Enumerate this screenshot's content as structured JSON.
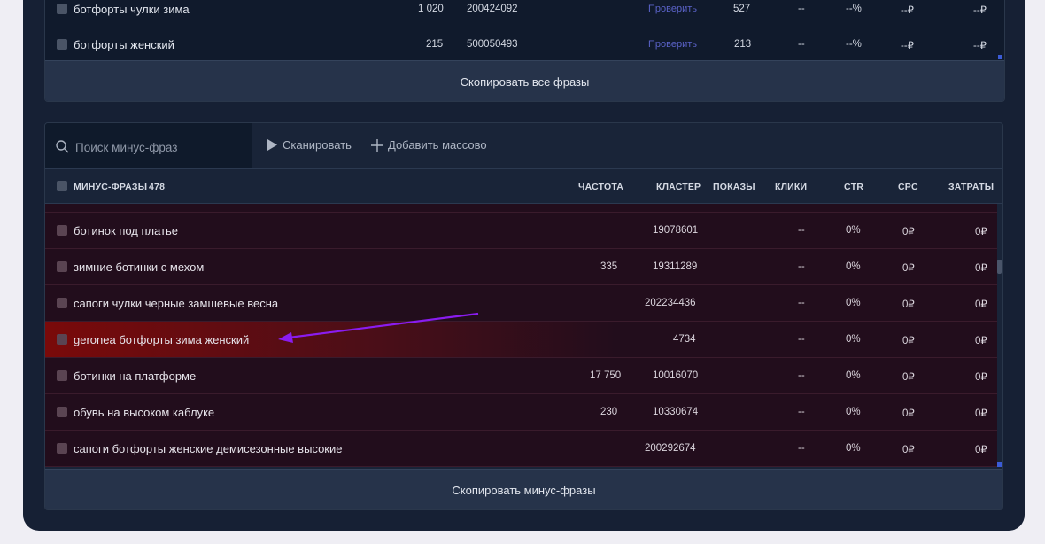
{
  "top_table": {
    "rows": [
      {
        "phrase": "ботфорты чулки зима",
        "freq": "1 020",
        "cluster": "200424092",
        "check": "Проверить",
        "shows": "527",
        "clicks": "--",
        "ctr": "--%",
        "cpc": "--₽",
        "cost": "--₽"
      },
      {
        "phrase": "ботфорты женский",
        "freq": "215",
        "cluster": "500050493",
        "check": "Проверить",
        "shows": "213",
        "clicks": "--",
        "ctr": "--%",
        "cpc": "--₽",
        "cost": "--₽"
      }
    ],
    "copy_all_label": "Скопировать все фразы"
  },
  "toolbar": {
    "search_placeholder": "Поиск минус-фраз",
    "scan_label": "Сканировать",
    "add_bulk_label": "Добавить массово"
  },
  "header": {
    "title": "МИНУС-ФРАЗЫ",
    "count": "478",
    "col_freq": "ЧАСТОТА",
    "col_cluster": "КЛАСТЕР",
    "col_shows": "ПОКАЗЫ",
    "col_clicks": "КЛИКИ",
    "col_ctr": "CTR",
    "col_cpc": "CPC",
    "col_cost": "ЗАТРАТЫ"
  },
  "minus_rows": [
    {
      "phrase": "ботинок под платье",
      "freq": "",
      "cluster": "19078601",
      "clicks": "--",
      "ctr": "0%",
      "cpc": "0₽",
      "cost": "0₽"
    },
    {
      "phrase": "зимние ботинки с мехом",
      "freq": "335",
      "cluster": "19311289",
      "clicks": "--",
      "ctr": "0%",
      "cpc": "0₽",
      "cost": "0₽"
    },
    {
      "phrase": "сапоги чулки черные замшевые весна",
      "freq": "",
      "cluster": "202234436",
      "clicks": "--",
      "ctr": "0%",
      "cpc": "0₽",
      "cost": "0₽"
    },
    {
      "phrase": "geronea ботфорты зима женский",
      "freq": "",
      "cluster": "4734",
      "clicks": "--",
      "ctr": "0%",
      "cpc": "0₽",
      "cost": "0₽"
    },
    {
      "phrase": "ботинки на платформе",
      "freq": "17 750",
      "cluster": "10016070",
      "clicks": "--",
      "ctr": "0%",
      "cpc": "0₽",
      "cost": "0₽"
    },
    {
      "phrase": "обувь на высоком каблуке",
      "freq": "230",
      "cluster": "10330674",
      "clicks": "--",
      "ctr": "0%",
      "cpc": "0₽",
      "cost": "0₽"
    },
    {
      "phrase": "сапоги ботфорты женские демисезонные высокие",
      "freq": "",
      "cluster": "200292674",
      "clicks": "--",
      "ctr": "0%",
      "cpc": "0₽",
      "cost": "0₽"
    }
  ],
  "copy_minus_label": "Скопировать минус-фразы",
  "colors": {
    "accent_check": "#5b63c9",
    "highlight_row": "#7a0a0a",
    "arrow": "#8a1cf0"
  }
}
